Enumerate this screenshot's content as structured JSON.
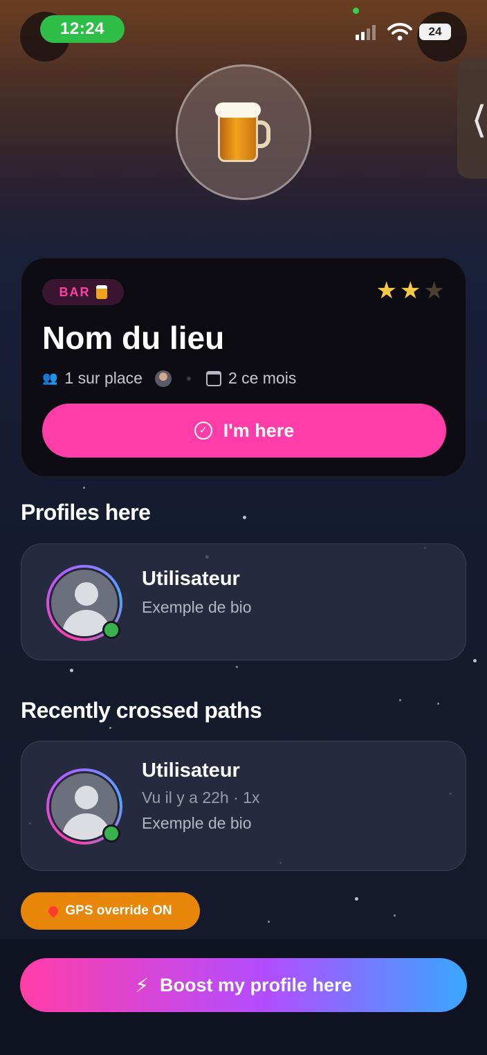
{
  "status_bar": {
    "time": "12:24",
    "battery": "24"
  },
  "side_tab": {
    "glyph": "❬"
  },
  "venue": {
    "category_label": "BAR",
    "rating": {
      "value": 2,
      "max": 3
    },
    "name": "Nom du lieu",
    "present_count": "1 sur place",
    "month_count": "2 ce mois",
    "checkin_label": "I'm here"
  },
  "profiles_here": {
    "title": "Profiles here",
    "items": [
      {
        "name": "Utilisateur",
        "bio": "Exemple de bio",
        "online": true
      }
    ]
  },
  "crossed_paths": {
    "title": "Recently crossed paths",
    "items": [
      {
        "name": "Utilisateur",
        "seen": "Vu il y a 22h · 1x",
        "bio": "Exemple de bio",
        "online": true
      }
    ]
  },
  "gps_override": {
    "label": "GPS override ON"
  },
  "boost": {
    "label": "Boost my profile here"
  },
  "colors": {
    "accent_pink": "#ff3da8",
    "online_green": "#37b24d",
    "gps_orange": "#e8860a",
    "boost_blue": "#3aa6ff"
  },
  "icons": [
    "beer-mug-icon",
    "star-icon",
    "people-icon",
    "calendar-icon",
    "check-circle-icon",
    "location-pin-icon",
    "lightning-icon",
    "wifi-icon",
    "signal-icon",
    "battery-icon",
    "chevron-left-icon"
  ]
}
